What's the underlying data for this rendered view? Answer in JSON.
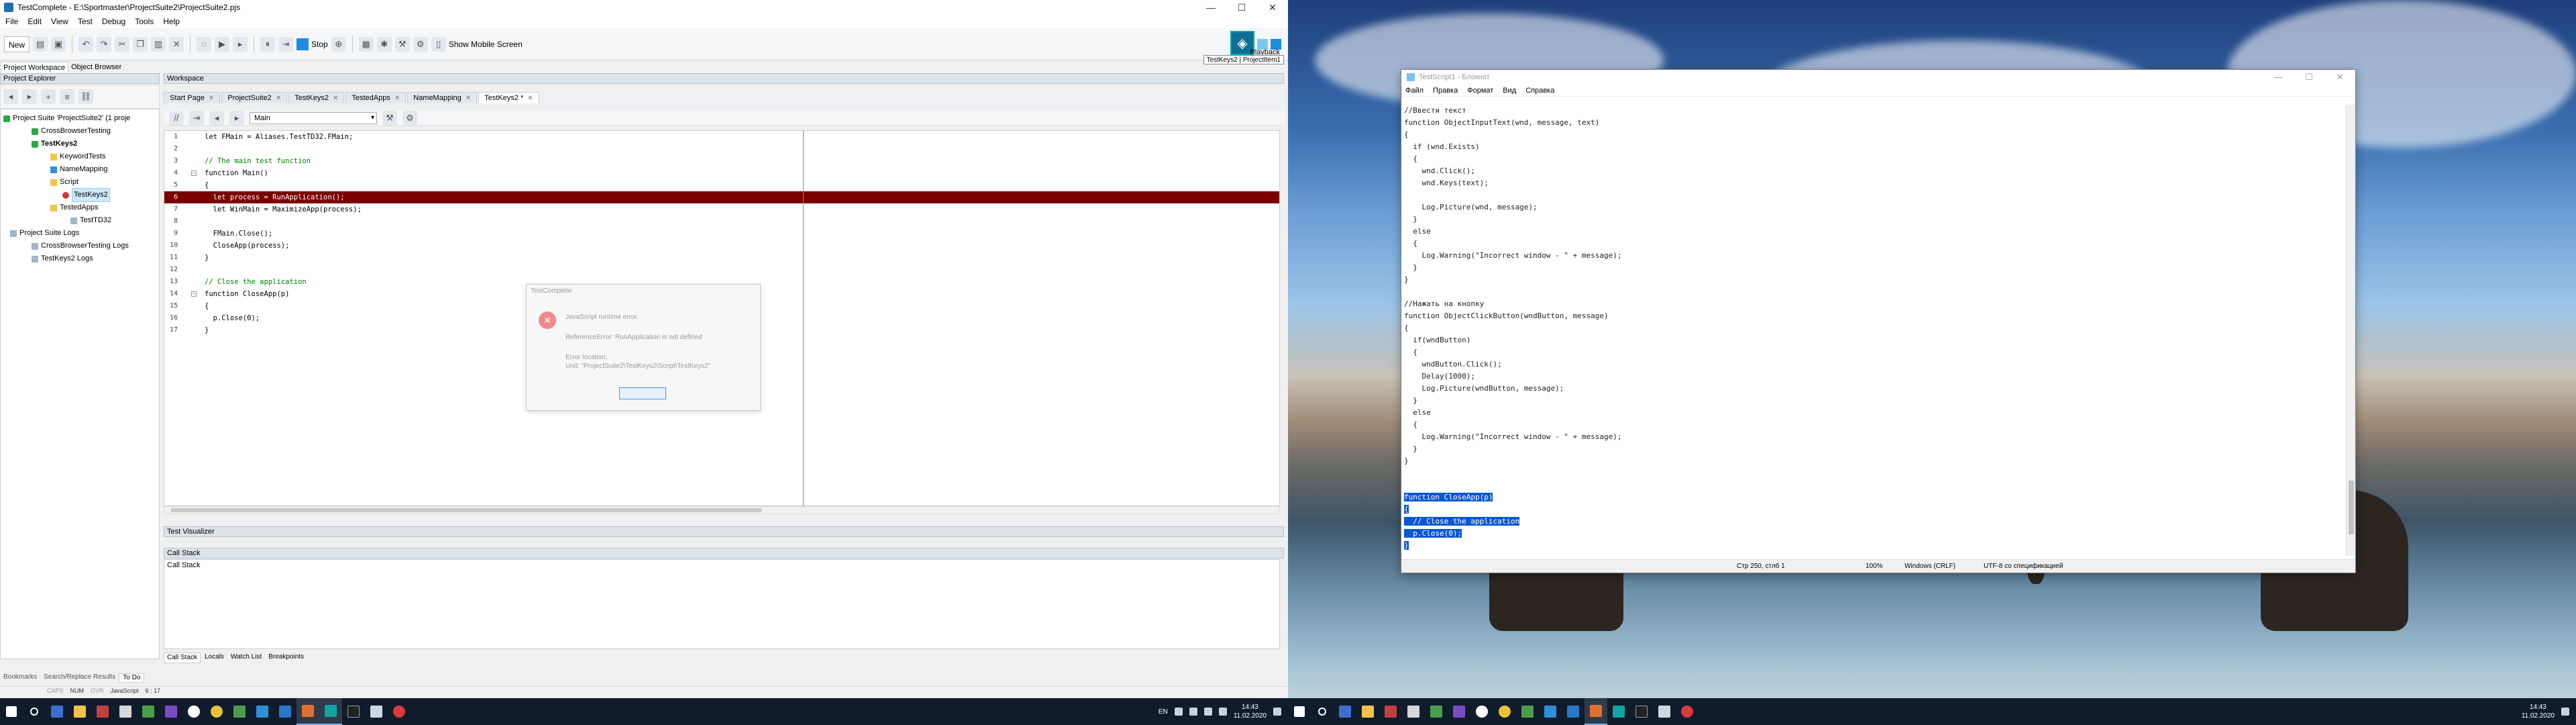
{
  "left": {
    "title": "TestComplete - E:\\Sportmaster\\ProjectSuite2\\ProjectSuite2.pjs",
    "window_controls": [
      "—",
      "☐",
      "✕"
    ],
    "menu": [
      "File",
      "Edit",
      "View",
      "Test",
      "Debug",
      "Tools",
      "Help"
    ],
    "toolbar": {
      "new_label": "New",
      "stop_label": "Stop",
      "mobile_label": "Show Mobile Screen",
      "playback_label": "Playback",
      "playback_test": "TestKeys2 | ProjectItem1"
    },
    "panel_tabs": [
      "Project Workspace",
      "Object Browser"
    ],
    "project_explorer_title": "Project Explorer",
    "tree": [
      {
        "label": "Project Suite 'ProjectSuite2' (1 proje",
        "icon": "check-icon",
        "bold": false
      },
      {
        "label": "CrossBrowserTesting",
        "icon": "check-icon",
        "bold": false
      },
      {
        "label": "TestKeys2",
        "icon": "check-icon",
        "bold": true
      },
      {
        "label": "KeywordTests",
        "icon": "folder-icon",
        "bold": false
      },
      {
        "label": "NameMapping",
        "icon": "blue-icon",
        "bold": false
      },
      {
        "label": "Script",
        "icon": "folder-icon",
        "bold": false
      },
      {
        "label": "TestKeys2",
        "icon": "red-icon",
        "bold": false,
        "selected": true
      },
      {
        "label": "TestedApps",
        "icon": "folder-icon",
        "bold": false
      },
      {
        "label": "TestTD32",
        "icon": "doc-icon",
        "bold": false
      },
      {
        "label": "Project Suite Logs",
        "icon": "doc-icon",
        "bold": false
      },
      {
        "label": "CrossBrowserTesting Logs",
        "icon": "doc-icon",
        "bold": false
      },
      {
        "label": "TestKeys2 Logs",
        "icon": "doc-icon",
        "bold": false
      }
    ],
    "pe_bottom_tabs": [
      "Bookmarks",
      "Search/Replace Results",
      "To Do"
    ],
    "workspace_title": "Workspace",
    "ws_tabs": [
      "Start Page",
      "ProjectSuite2",
      "TestKeys2",
      "TestedApps",
      "NameMapping",
      "TestKeys2 *"
    ],
    "routine_select": "Main",
    "code": [
      {
        "n": "1",
        "t": "let FMain = Aliases.TestTD32.FMain;"
      },
      {
        "n": "2",
        "t": ""
      },
      {
        "n": "3",
        "t": "// The main test function"
      },
      {
        "n": "4",
        "t": "function Main()"
      },
      {
        "n": "5",
        "t": "{"
      },
      {
        "n": "6",
        "t": "  let process = RunApplication();"
      },
      {
        "n": "7",
        "t": "  let WinMain = MaximizeApp(process);"
      },
      {
        "n": "8",
        "t": ""
      },
      {
        "n": "9",
        "t": "  FMain.Close();"
      },
      {
        "n": "10",
        "t": "  CloseApp(process);"
      },
      {
        "n": "11",
        "t": "}"
      },
      {
        "n": "12",
        "t": ""
      },
      {
        "n": "13",
        "t": "// Close the application"
      },
      {
        "n": "14",
        "t": "function CloseApp(p)"
      },
      {
        "n": "15",
        "t": "{"
      },
      {
        "n": "16",
        "t": "  p.Close(0);"
      },
      {
        "n": "17",
        "t": "}"
      }
    ],
    "test_visualizer_title": "Test Visualizer",
    "call_stack_title": "Call Stack",
    "call_stack_body": "Call Stack",
    "bottom_tabs": [
      "Call Stack",
      "Locals",
      "Watch List",
      "Breakpoints"
    ],
    "status": {
      "caps": "CAPS",
      "num": "NUM",
      "ovr": "OVR",
      "lang": "JavaScript",
      "pos": "6 : 17"
    },
    "dialog": {
      "title": "TestComplete",
      "msg1": "JavaScript runtime error.",
      "msg2": "ReferenceError: RunApplication is not defined",
      "msg3": "Error location:",
      "msg4": "Unit: \"ProjectSuite2\\TestKeys2\\Script\\TestKeys2\""
    },
    "tray": {
      "lang": "EN",
      "time": "14:43",
      "date": "11.02.2020"
    }
  },
  "right": {
    "notepad": {
      "title": "TestScript1 - Блокнот",
      "menu": [
        "Файл",
        "Правка",
        "Формат",
        "Вид",
        "Справка"
      ],
      "lines": [
        "//Ввести текст",
        "function ObjectInputText(wnd, message, text)",
        "{",
        "  if (wnd.Exists)",
        "  {",
        "    wnd.Click();",
        "    wnd.Keys(text);",
        "",
        "    Log.Picture(wnd, message);",
        "  }",
        "  else",
        "  {",
        "    Log.Warning(\"Incorrect window - \" + message);",
        "  }",
        "}",
        "",
        "//Нажать на кнопку",
        "function ObjectClickButton(wndButton, message)",
        "{",
        "  if(wndButton)",
        "  {",
        "    wndButton.Click();",
        "    Delay(1000);",
        "    Log.Picture(wndButton, message);",
        "  }",
        "  else",
        "  {",
        "    Log.Warning(\"Incorrect window - \" + message);",
        "  }",
        "}",
        "",
        "",
        "function CloseApp(p)",
        "{",
        "  // Close the application",
        "  p.Close(0);",
        "}"
      ],
      "status": {
        "pos": "Стр 250, стлб 1",
        "zoom": "100%",
        "eol": "Windows (CRLF)",
        "enc": "UTF-8 со спецификацией"
      }
    },
    "tray": {
      "time": "14:43",
      "date": "11.02.2020"
    }
  },
  "colors": {
    "error_line": "#7a0000",
    "selection": "#0b57d0",
    "accent": "#1e8de0"
  }
}
